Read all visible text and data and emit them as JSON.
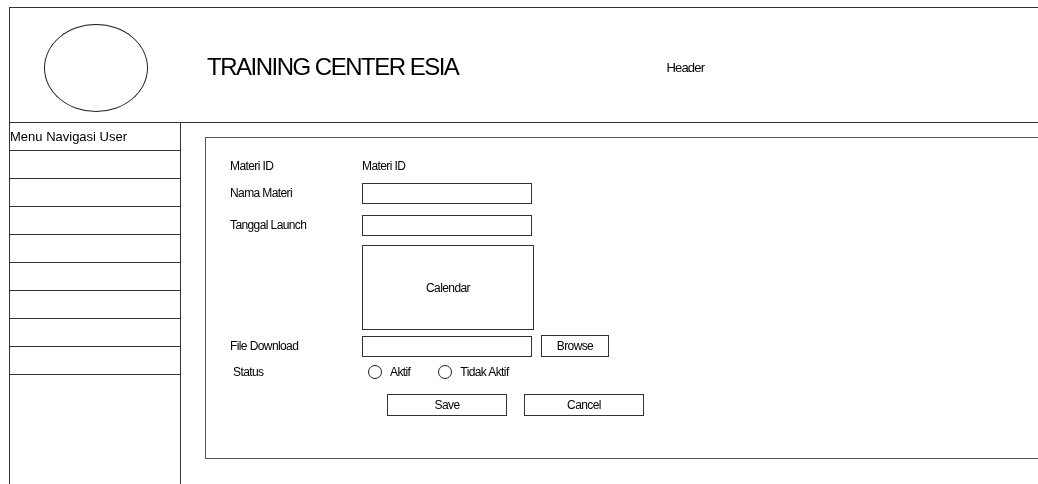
{
  "header": {
    "title": "TRAINING CENTER ESIA",
    "label": "Header"
  },
  "sidebar": {
    "title": "Menu Navigasi User"
  },
  "form": {
    "materi_id": {
      "label": "Materi ID",
      "value": "Materi ID"
    },
    "nama_materi": {
      "label": "Nama Materi"
    },
    "tanggal_launch": {
      "label": "Tanggal Launch"
    },
    "calendar": {
      "label": "Calendar"
    },
    "file_download": {
      "label": "File Download",
      "button": "Browse"
    },
    "status": {
      "label": "Status",
      "options": [
        {
          "label": "Aktif",
          "selected": false
        },
        {
          "label": "Tidak Aktif",
          "selected": false
        }
      ]
    },
    "buttons": [
      "Save",
      "Cancel"
    ]
  }
}
